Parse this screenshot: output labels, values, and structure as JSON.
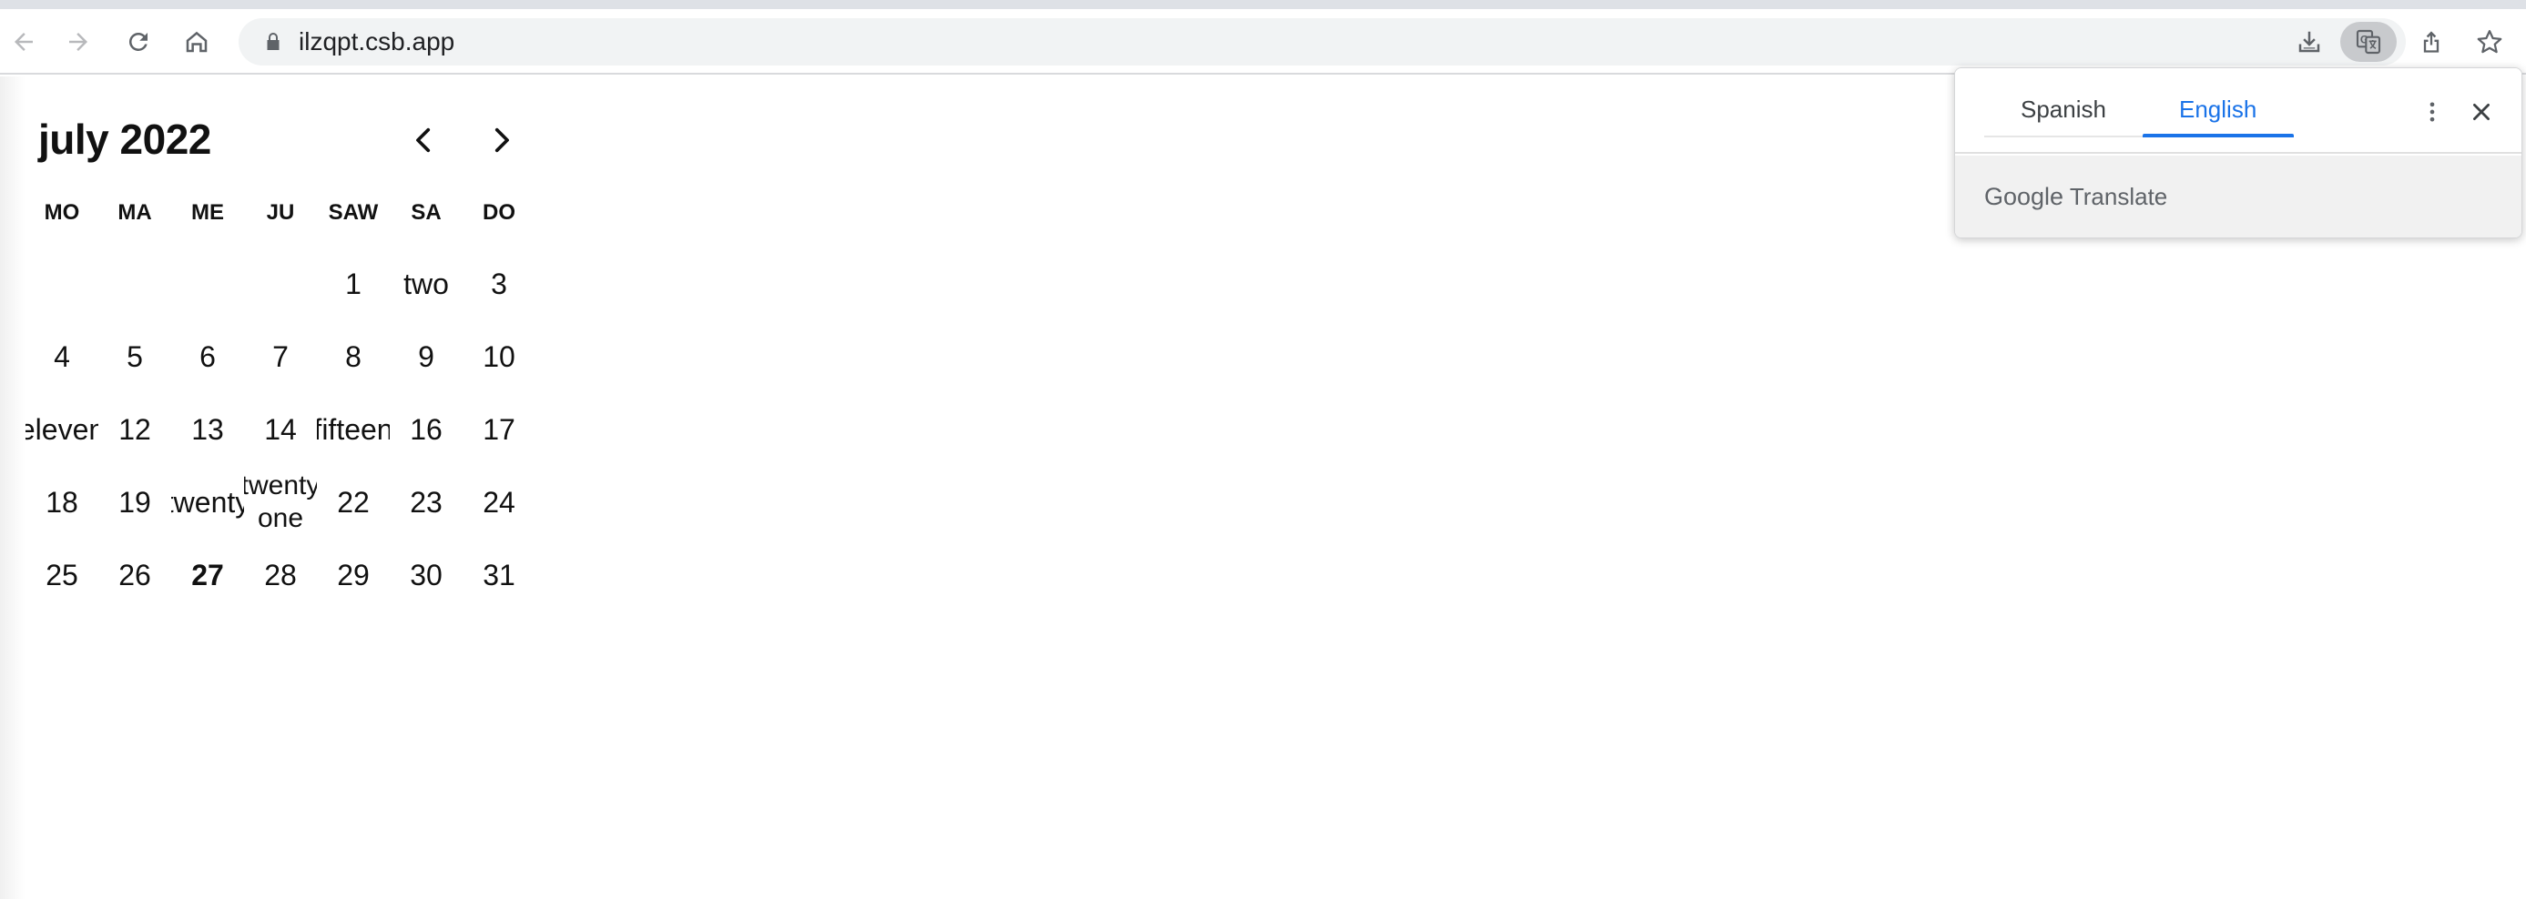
{
  "browser": {
    "url": "ilzqpt.csb.app",
    "icons": {
      "back": "arrow-left-icon",
      "forward": "arrow-right-icon",
      "reload": "reload-icon",
      "home": "home-icon",
      "lock": "lock-icon",
      "install": "install-app-icon",
      "translate": "translate-icon",
      "share": "share-icon",
      "bookmark": "star-icon"
    }
  },
  "calendar": {
    "title": "july 2022",
    "weekdays": [
      "MO",
      "MA",
      "ME",
      "JU",
      "SAW",
      "SA",
      "DO"
    ],
    "days": [
      "",
      "",
      "",
      "",
      "1",
      "two",
      "3",
      "4",
      "5",
      "6",
      "7",
      "8",
      "9",
      "10",
      "eleven",
      "12",
      "13",
      "14",
      "fifteen",
      "16",
      "17",
      "18",
      "19",
      "twenty",
      "twenty one",
      "22",
      "23",
      "24",
      "25",
      "26",
      "27",
      "28",
      "29",
      "30",
      "31"
    ],
    "today": "27"
  },
  "translate_popup": {
    "tabs": [
      {
        "label": "Spanish",
        "active": false
      },
      {
        "label": "English",
        "active": true
      }
    ],
    "brand_google": "Google",
    "brand_translate": "Translate",
    "accent_color": "#1a73e8"
  }
}
